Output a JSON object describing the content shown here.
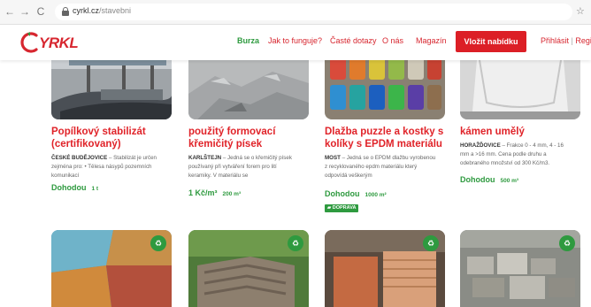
{
  "browser": {
    "back": "←",
    "forward": "→",
    "reload": "C",
    "url_host": "cyrkl.cz",
    "url_path": "/stavebni",
    "star": "☆"
  },
  "header": {
    "logo": "YRKL",
    "menu": [
      "Burza",
      "Jak to funguje?",
      "Časté dotazy",
      "O nás",
      "Magazín"
    ],
    "cta": "Vložit nabídku",
    "login": "Přihlásit",
    "register": "Regi"
  },
  "colors": {
    "brand_red": "#dc1f26",
    "green": "#2e9a3f"
  },
  "cards": [
    {
      "title": "Popílkový stabilizát (certifikovaný)",
      "location": "ČESKÉ BUDĚJOVICE",
      "desc": "– Stabilizát je určen zejména pro: • Tělesa násypů pozemních komunikací",
      "price": "Dohodou",
      "qty": "1 t"
    },
    {
      "title": "použitý formovací křemičitý písek",
      "location": "KARLŠTEJN",
      "desc": "– Jedná se o křemičitý písek používaný při vytváření forem pro lití keramiky. V materiálu se",
      "price": "1 Kč/m³",
      "qty": "200 m³"
    },
    {
      "title": "Dlažba puzzle a kostky s kolíky s EPDM materiálu",
      "location": "MOST",
      "desc": "– Jedná se o EPDM dlažbu vyrobenou z recyklovaného epdm materiálu který odpovídá veškerým",
      "price": "Dohodou",
      "qty": "1000 m²",
      "badge": "DOPRAVA"
    },
    {
      "title": "kámen umělý",
      "location": "HORAŽĎOVICE",
      "desc": "– Frakce 0 - 4 mm, 4 - 16 mm a >16 mm. Cena podle druhu a odebraného množství od 300 Kč/m3.",
      "price": "Dohodou",
      "qty": "500 m³"
    }
  ],
  "fav_icon": "♻"
}
